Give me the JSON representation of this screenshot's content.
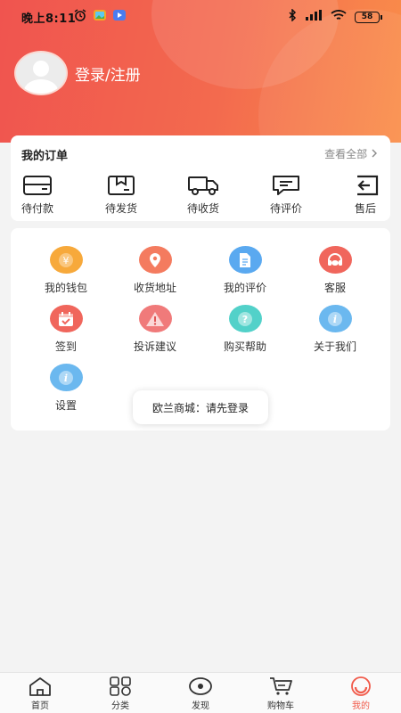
{
  "status_bar": {
    "time": "晚上8:11",
    "battery": "58"
  },
  "profile": {
    "login_label": "登录/注册"
  },
  "orders": {
    "title": "我的订单",
    "view_all": "查看全部",
    "items": [
      {
        "label": "待付款",
        "icon": "wallet-icon"
      },
      {
        "label": "待发货",
        "icon": "box-icon"
      },
      {
        "label": "待收货",
        "icon": "truck-icon"
      },
      {
        "label": "待评价",
        "icon": "chat-icon"
      },
      {
        "label": "售后",
        "icon": "return-icon"
      }
    ]
  },
  "services": [
    {
      "label": "我的钱包",
      "icon": "yen-icon",
      "color": "#f7a93b"
    },
    {
      "label": "收货地址",
      "icon": "location-icon",
      "color": "#f47b5f"
    },
    {
      "label": "我的评价",
      "icon": "document-icon",
      "color": "#5aa9f0"
    },
    {
      "label": "客服",
      "icon": "headset-icon",
      "color": "#f0665c"
    },
    {
      "label": "签到",
      "icon": "calendar-check-icon",
      "color": "#f0665c"
    },
    {
      "label": "投诉建议",
      "icon": "warning-icon",
      "color": "#f07a7a"
    },
    {
      "label": "购买帮助",
      "icon": "help-icon",
      "color": "#52d1c9"
    },
    {
      "label": "关于我们",
      "icon": "info-icon",
      "color": "#6bb8ef"
    },
    {
      "label": "设置",
      "icon": "info-icon",
      "color": "#6bb8ef"
    }
  ],
  "toast": {
    "message": "欧兰商城：请先登录"
  },
  "tabbar": {
    "items": [
      {
        "label": "首页",
        "icon": "home-icon"
      },
      {
        "label": "分类",
        "icon": "category-icon"
      },
      {
        "label": "发现",
        "icon": "eye-icon"
      },
      {
        "label": "购物车",
        "icon": "cart-icon"
      },
      {
        "label": "我的",
        "icon": "profile-icon",
        "active": true
      }
    ]
  },
  "colors": {
    "accent": "#f15a4a",
    "header_start": "#f0544f",
    "header_end": "#fa8e4a"
  }
}
